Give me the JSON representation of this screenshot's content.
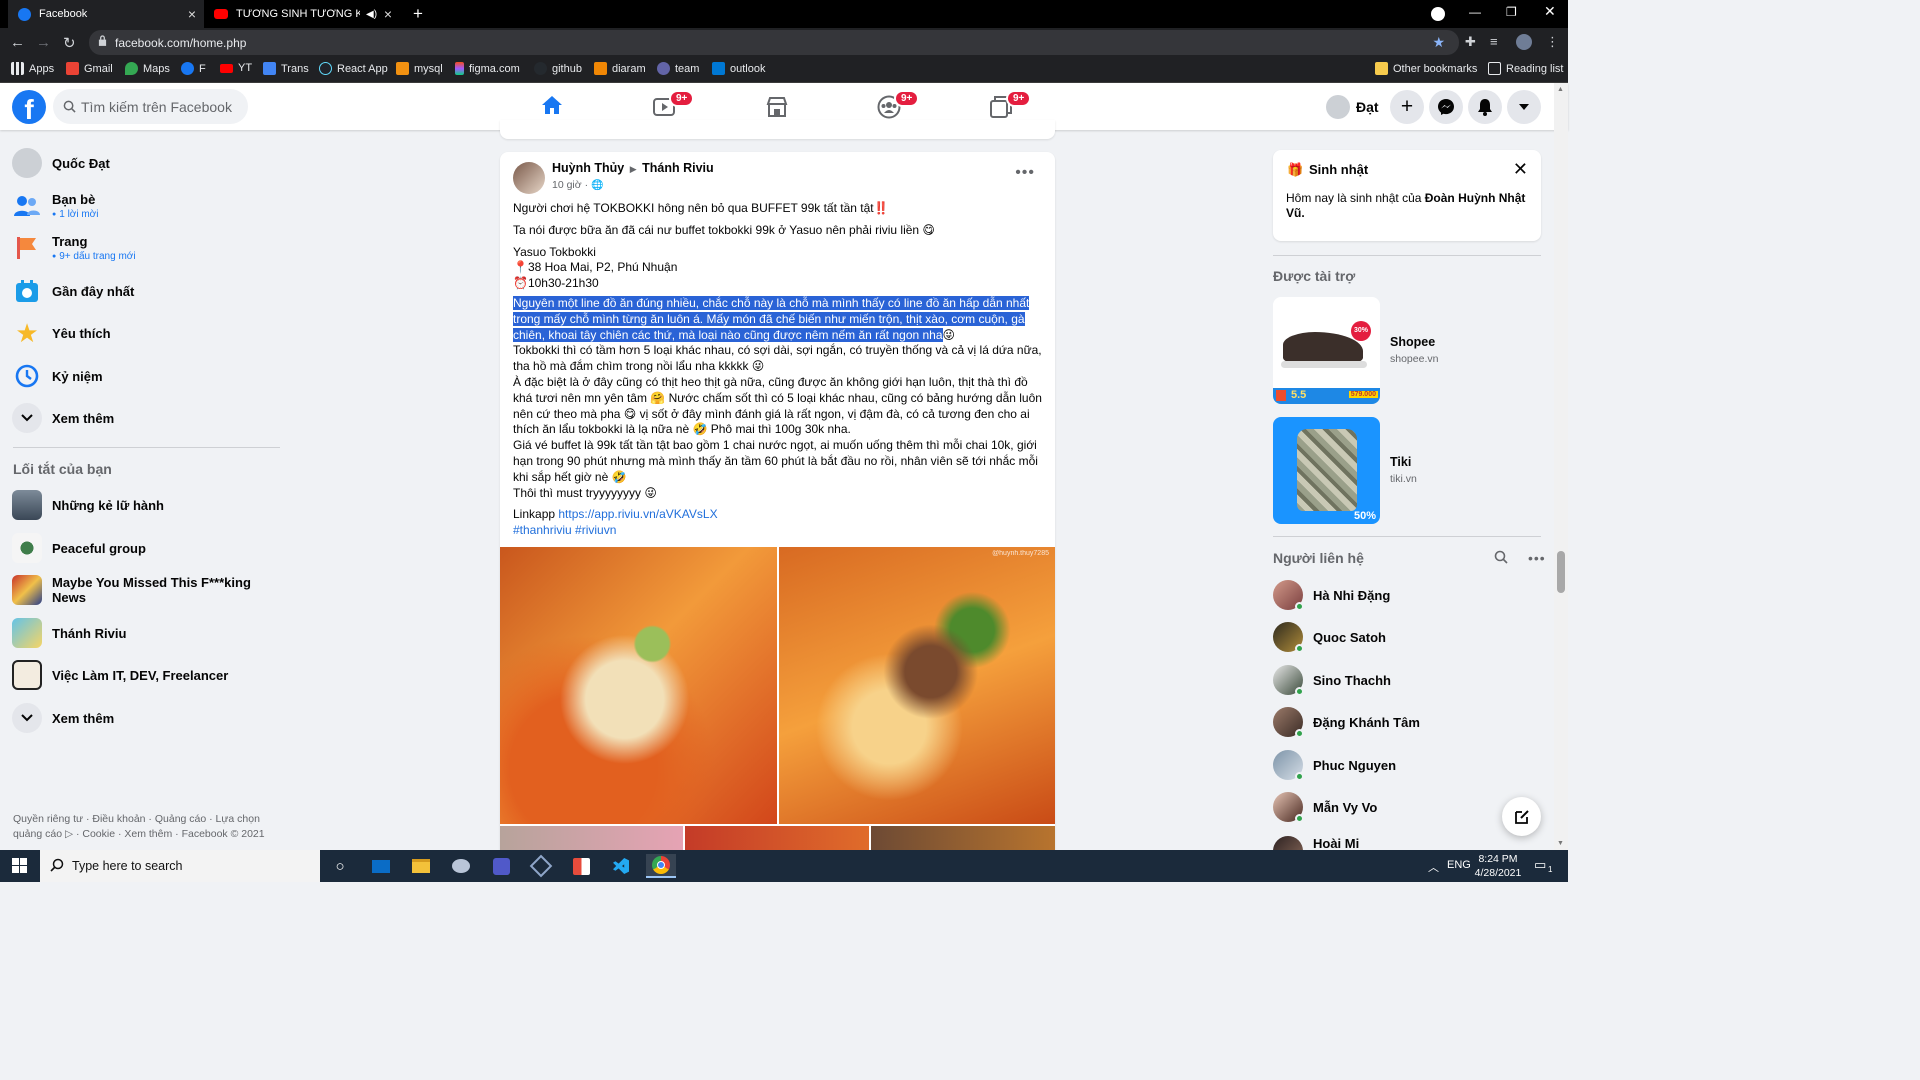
{
  "browser": {
    "tabs": [
      {
        "title": "Facebook",
        "active": true
      },
      {
        "title": "TƯƠNG SINH TƯƠNG KHẮC",
        "active": false
      }
    ],
    "url": "facebook.com/home.php",
    "bookmarks": [
      "Apps",
      "Gmail",
      "Maps",
      "F",
      "YT",
      "Trans",
      "React App",
      "mysql",
      "figma.com",
      "github",
      "diaram",
      "team",
      "outlook"
    ],
    "other_bookmarks": "Other bookmarks",
    "reading_list": "Reading list"
  },
  "header": {
    "search_placeholder": "Tìm kiếm trên Facebook",
    "badges": {
      "watch": "9+",
      "groups": "9+",
      "gaming": "9+"
    },
    "profile_name": "Đạt"
  },
  "sidebar": {
    "profile": "Quốc Đạt",
    "items": [
      {
        "label": "Bạn bè",
        "sub": "1 lời mời"
      },
      {
        "label": "Trang",
        "sub": "9+ dấu trang mới"
      },
      {
        "label": "Gần đây nhất"
      },
      {
        "label": "Yêu thích"
      },
      {
        "label": "Kỷ niệm"
      },
      {
        "label": "Xem thêm"
      }
    ],
    "shortcuts_heading": "Lối tắt của bạn",
    "shortcuts": [
      "Những kẻ lữ hành",
      "Peaceful group",
      "Maybe You Missed This F***king News",
      "Thánh Riviu",
      "Việc Làm IT, DEV, Freelancer"
    ],
    "shortcuts_more": "Xem thêm",
    "footer": "Quyền riêng tư · Điều khoản · Quảng cáo · Lựa chọn quảng cáo ▷ · Cookie · Xem thêm · Facebook © 2021"
  },
  "post": {
    "author": "Huỳnh Thủy",
    "group": "Thánh Riviu",
    "time": "10 giờ ·",
    "p1": "Người chơi hệ TOKBOKKI hông nên bỏ qua BUFFET 99k tất tần tật‼️",
    "p2": "Ta nói được bữa ăn đã cái nư buffet tokbokki 99k ở Yasuo nên phải riviu liền 😋",
    "place_name": "Yasuo Tokbokki",
    "address": "📍38 Hoa Mai, P2, Phú Nhuận",
    "hours": "⏰10h30-21h30",
    "highlighted": "Nguyên một line đồ ăn đúng nhiều, chắc chỗ này là chỗ mà mình thấy có line đồ ăn hấp dẫn nhất trong mấy chỗ mình từng ăn luôn á. Mấy món đã chế biến như miến trộn, thịt xào, cơm cuộn, gà chiên, khoai tây chiên các thứ, mà loại nào cũng được nêm nếm ăn rất ngon nha",
    "highlight_emoji": "😜",
    "p3": "Tokbokki thì có tầm hơn 5 loại khác nhau, có sợi dài, sợi ngắn, có truyền thống và cả vị lá dứa nữa, tha hồ mà đắm chìm trong nồi lẩu nha kkkkk 😜",
    "p4": "À đặc biệt là ở đây cũng có thịt heo thịt gà nữa, cũng được ăn không giới hạn luôn, thịt thà thì đồ khá tươi nên mn yên tâm 🤗 Nước chấm sốt thì có 5 loại khác nhau, cũng có bảng hướng dẫn luôn nên cứ theo mà pha 😋 vị sốt ở đây mình đánh giá là rất ngon, vị đậm đà, có cả tương đen cho ai thích ăn lẩu tokbokki là lạ nữa nè 🤣 Phô mai thì 100g 30k nha.",
    "p5": "Giá vé buffet là 99k tất tần tật bao gồm 1 chai nước ngọt, ai muốn uống thêm thì mỗi chai 10k, giới hạn trong 90 phút nhưng mà mình thấy ăn tầm 60 phút là bắt đầu no rồi, nhân viên sẽ tới nhắc mỗi khi sắp hết giờ nè 🤣",
    "p6": "Thôi thì must tryyyyyyyy 😜",
    "link_label": "Linkapp ",
    "link": "https://app.riviu.vn/aVKAVsLX",
    "hashtags": "#thanhriviu #riviuvn",
    "watermark": "@huynh.thuy7285"
  },
  "right": {
    "birthday_title": "Sinh nhật",
    "birthday_msg_prefix": "Hôm nay là sinh nhật của ",
    "birthday_name": "Đoàn Huỳnh Nhật Vũ.",
    "sponsored_heading": "Được tài trợ",
    "ads": [
      {
        "name": "Shopee",
        "domain": "shopee.vn",
        "promo": "5.5",
        "price": "579.000",
        "sale": "30%"
      },
      {
        "name": "Tiki",
        "domain": "tiki.vn",
        "sale": "50%"
      }
    ],
    "contacts_heading": "Người liên hệ",
    "contacts": [
      "Hà Nhi Đặng",
      "Quoc Satoh",
      "Sino Thachh",
      "Đặng Khánh Tâm",
      "Phuc Nguyen",
      "Mẫn Vy Vo",
      "Hoài Mi"
    ]
  },
  "taskbar": {
    "search_placeholder": "Type here to search",
    "lang": "ENG",
    "time": "8:24 PM",
    "date": "4/28/2021",
    "notif_count": "1"
  }
}
